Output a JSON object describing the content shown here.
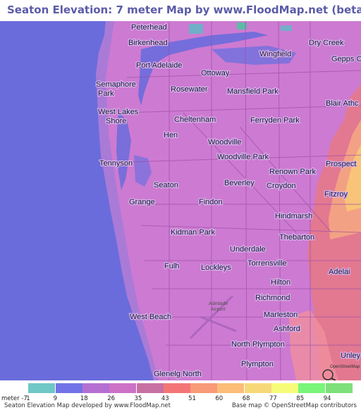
{
  "title": "Seaton Elevation: 7 meter Map by www.FloodMap.net (beta)",
  "map": {
    "places": [
      {
        "id": "peterhead",
        "text": "Peterhead"
      },
      {
        "id": "birkenhead",
        "text": "Birkenhead"
      },
      {
        "id": "dry-creek",
        "text": "Dry Creek"
      },
      {
        "id": "wingfield",
        "text": "Wingfield"
      },
      {
        "id": "gepps-cross",
        "text": "Gepps C"
      },
      {
        "id": "port-adelaide",
        "text": "Port Adelaide"
      },
      {
        "id": "ottoway",
        "text": "Ottoway"
      },
      {
        "id": "semaphore-park-1",
        "text": "Semaphore"
      },
      {
        "id": "semaphore-park-2",
        "text": "Park"
      },
      {
        "id": "rosewater",
        "text": "Rosewater"
      },
      {
        "id": "mansfield-park",
        "text": "Mansfield Park"
      },
      {
        "id": "blair-athol",
        "text": "Blair Athc"
      },
      {
        "id": "west-lakes-1",
        "text": "West Lakes"
      },
      {
        "id": "west-lakes-2",
        "text": "Shore"
      },
      {
        "id": "cheltenham",
        "text": "Cheltenham"
      },
      {
        "id": "ferryden-park",
        "text": "Ferryden Park"
      },
      {
        "id": "hendon",
        "text": "Hen"
      },
      {
        "id": "woodville",
        "text": "Woodville"
      },
      {
        "id": "woodville-park",
        "text": "Woodville Park"
      },
      {
        "id": "tennyson",
        "text": "Tennyson"
      },
      {
        "id": "prospect",
        "text": "Prospect"
      },
      {
        "id": "renown-park",
        "text": "Renown Park"
      },
      {
        "id": "seaton",
        "text": "Seaton"
      },
      {
        "id": "beverley",
        "text": "Beverley"
      },
      {
        "id": "croydon",
        "text": "Croydon"
      },
      {
        "id": "fitzroy",
        "text": "Fitzroy"
      },
      {
        "id": "grange",
        "text": "Grange"
      },
      {
        "id": "findon",
        "text": "Findon"
      },
      {
        "id": "hindmarsh",
        "text": "Hindmarsh"
      },
      {
        "id": "kidman-park",
        "text": "Kidman Park"
      },
      {
        "id": "thebarton",
        "text": "Thebarton"
      },
      {
        "id": "underdale",
        "text": "Underdale"
      },
      {
        "id": "torrensville",
        "text": "Torrensville"
      },
      {
        "id": "adelaide",
        "text": "Adelai"
      },
      {
        "id": "fulham",
        "text": "Fulh"
      },
      {
        "id": "lockleys",
        "text": "Lockleys"
      },
      {
        "id": "hilton",
        "text": "Hilton"
      },
      {
        "id": "richmond",
        "text": "Richmond"
      },
      {
        "id": "adelaide-airport-1",
        "text": "Adelaide"
      },
      {
        "id": "adelaide-airport-2",
        "text": "Airport"
      },
      {
        "id": "west-beach",
        "text": "West Beach"
      },
      {
        "id": "marleston",
        "text": "Marleston"
      },
      {
        "id": "ashford",
        "text": "Ashford"
      },
      {
        "id": "north-plympton",
        "text": "North Plympton"
      },
      {
        "id": "unley",
        "text": "Unley"
      },
      {
        "id": "plympton",
        "text": "Plympton"
      },
      {
        "id": "glenelg-north",
        "text": "Glenelg North"
      }
    ],
    "attribution_mark": "OpenStreetMap",
    "colors": {
      "sea": "#6a6cdc",
      "land": "#cd7ad2",
      "land_high": "#e37891"
    }
  },
  "legend": {
    "items": [
      {
        "label": "meter -7",
        "color": "#ffffff"
      },
      {
        "label": "1",
        "color": "#6fc7c6"
      },
      {
        "label": "9",
        "color": "#7273e6"
      },
      {
        "label": "18",
        "color": "#b56fd2"
      },
      {
        "label": "26",
        "color": "#cd71c7"
      },
      {
        "label": "35",
        "color": "#c770a2"
      },
      {
        "label": "43",
        "color": "#f37576"
      },
      {
        "label": "51",
        "color": "#f89a77"
      },
      {
        "label": "60",
        "color": "#fbbd77"
      },
      {
        "label": "68",
        "color": "#f7d878"
      },
      {
        "label": "77",
        "color": "#f6fb79"
      },
      {
        "label": "85",
        "color": "#79f57a"
      },
      {
        "label": "94",
        "color": "#7ee07a"
      }
    ]
  },
  "footer": {
    "left": "Seaton Elevation Map developed by www.FloodMap.net",
    "right": "Base map © OpenStreetMap contributors"
  }
}
